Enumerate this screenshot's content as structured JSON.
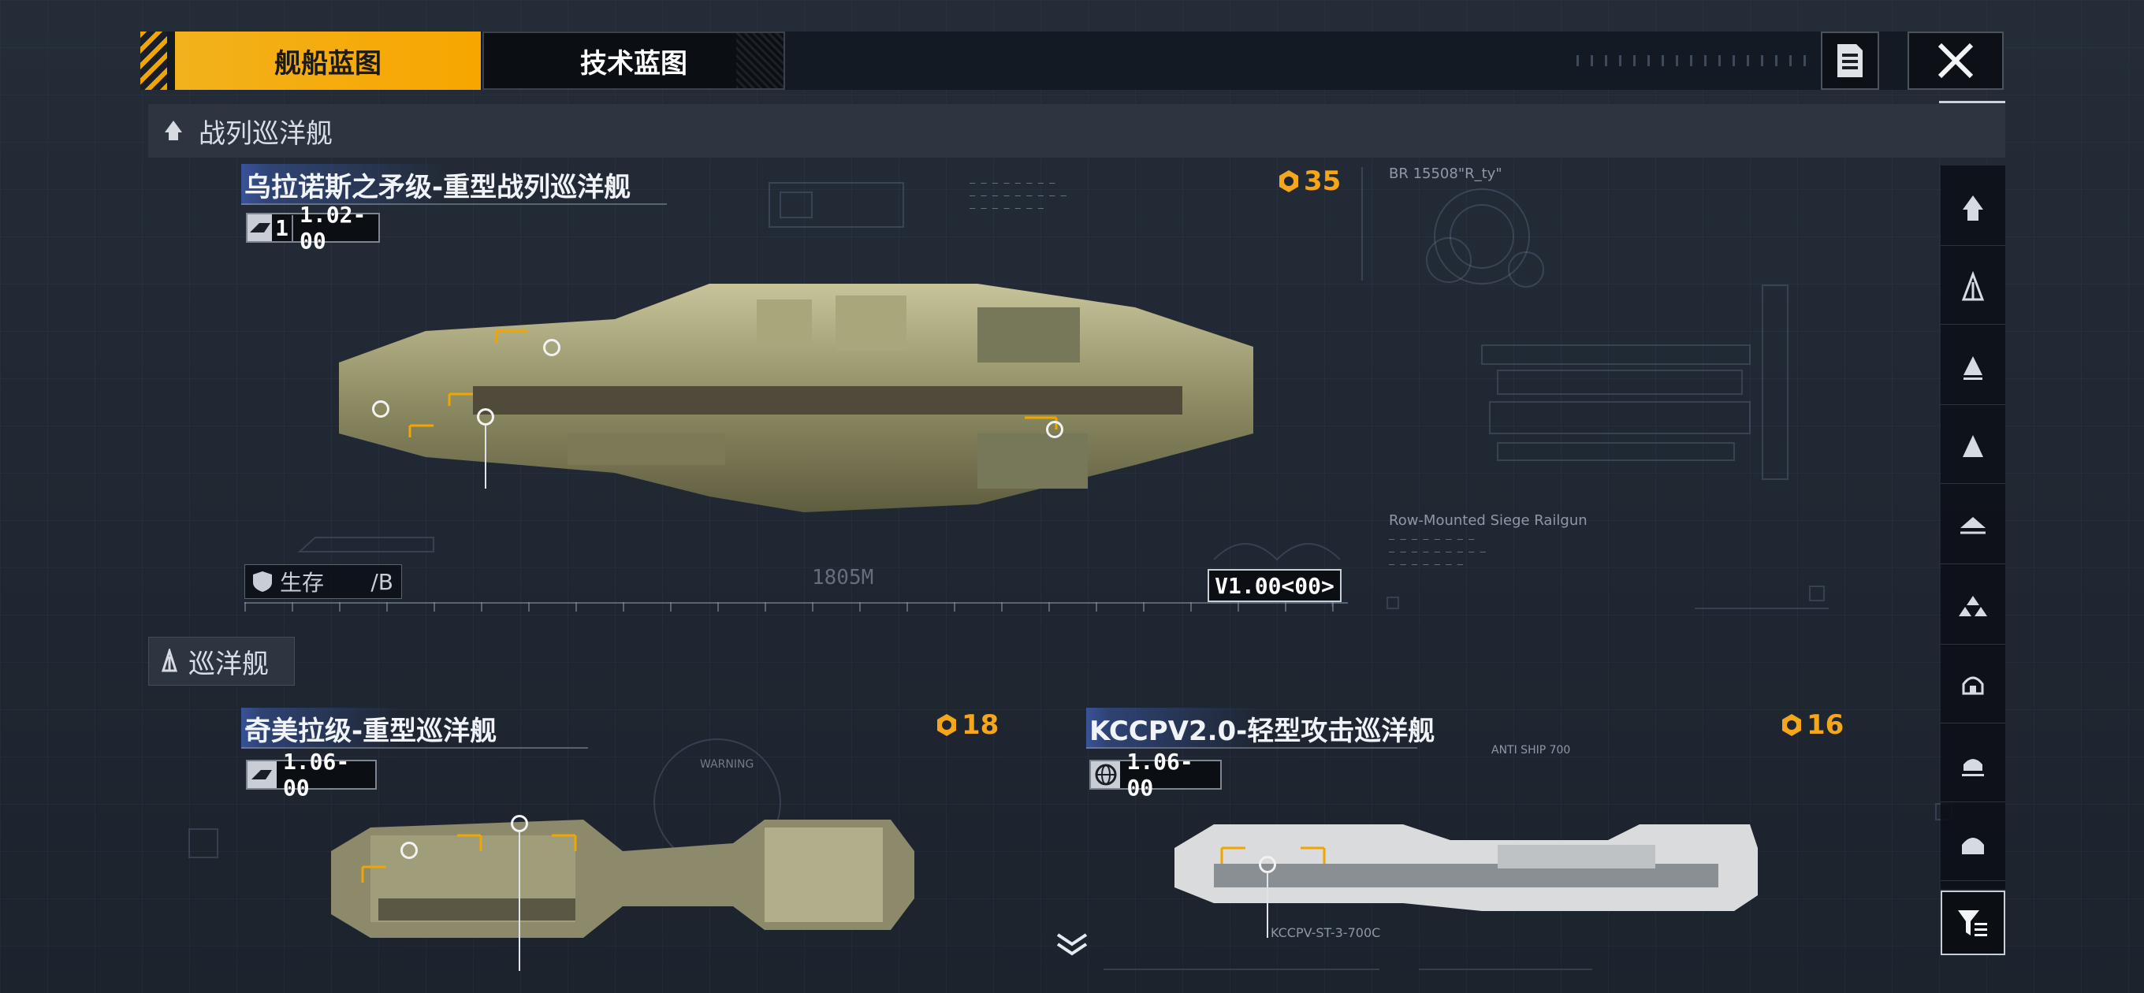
{
  "tabs": {
    "ship_blueprint": "舰船蓝图",
    "tech_blueprint": "技术蓝图"
  },
  "sections": {
    "battlecruiser": "战列巡洋舰",
    "cruiser": "巡洋舰"
  },
  "ships": {
    "main": {
      "name": "乌拉诺斯之矛级-重型战列巡洋舰",
      "version_prefix": "1",
      "version": "1.02-00",
      "cost": "35",
      "survival_label": "生存",
      "survival_value": "/B",
      "length": "1805M",
      "model_version": "V1.00<00>",
      "weapon_label": "Row-Mounted Siege Railgun",
      "code_label": "BR 15508\"R_ty\""
    },
    "chimera": {
      "name": "奇美拉级-重型巡洋舰",
      "version": "1.06-00",
      "cost": "18",
      "warning": "WARNING"
    },
    "kccpv": {
      "name": "KCCPV2.0-轻型攻击巡洋舰",
      "version": "1.06-00",
      "cost": "16",
      "code_label": "KCCPV-ST-3-700C",
      "anti_ship": "ANTI SHIP 700"
    }
  },
  "colors": {
    "accent": "#f6a61b",
    "tab_active": "#f2b21c",
    "name_highlight": "#3c5aaa"
  },
  "icons": {
    "doc": "document-icon",
    "close": "close-icon",
    "filter": "filter-icon",
    "expand": "chevron-down-icon"
  }
}
